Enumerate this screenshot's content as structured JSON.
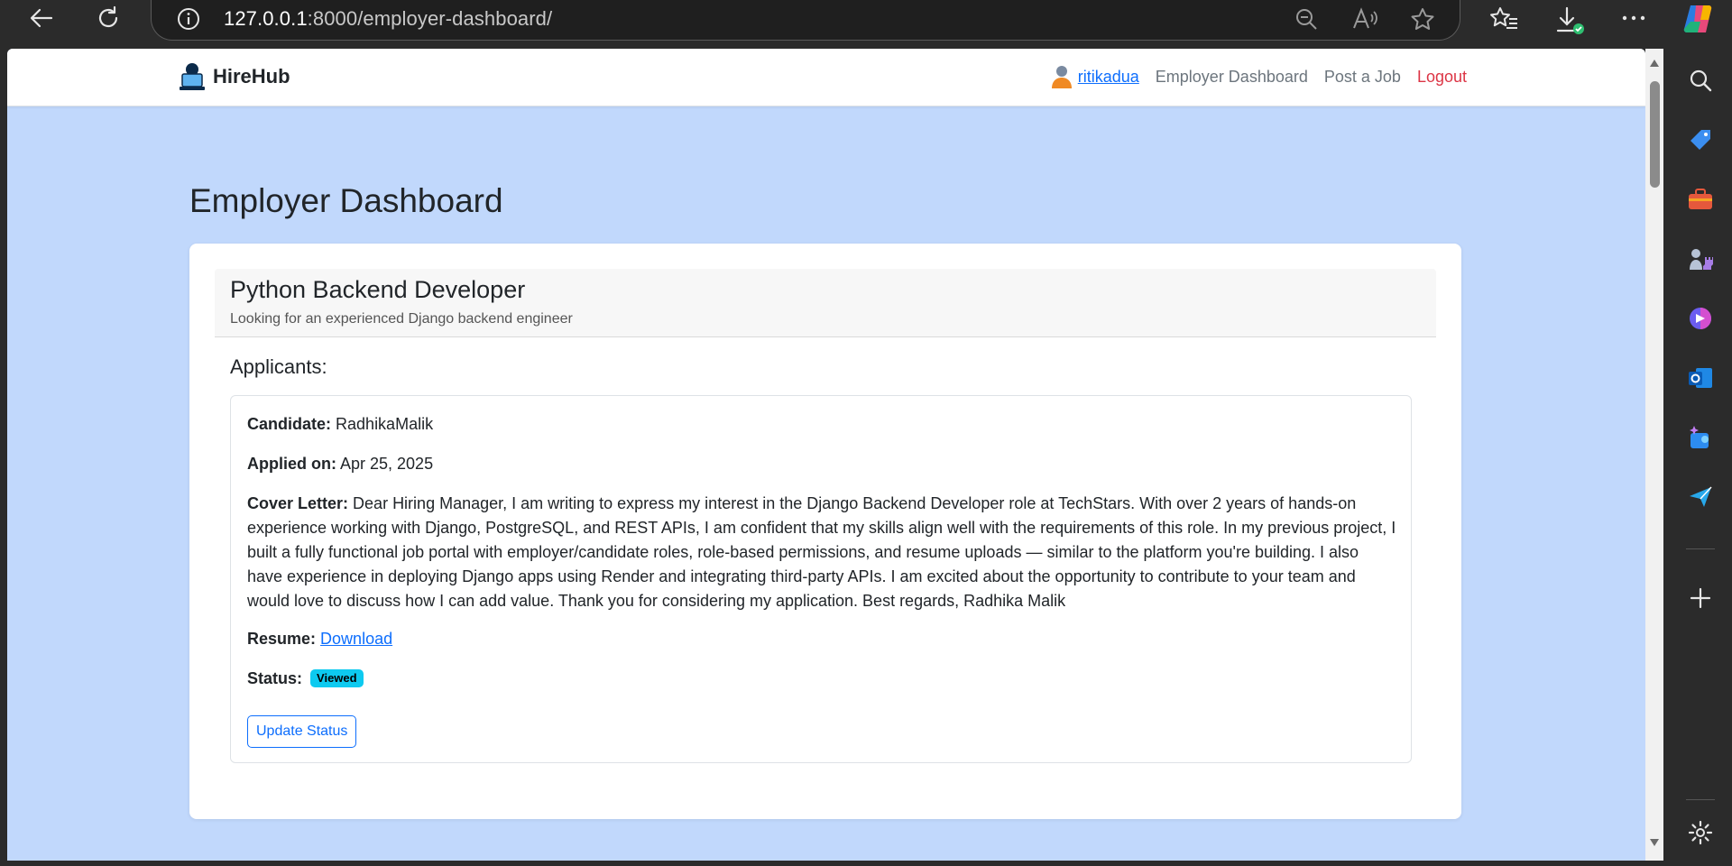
{
  "browser": {
    "url_host": "127.0.0.1",
    "url_rest": ":8000/employer-dashboard/"
  },
  "navbar": {
    "brand": "HireHub",
    "username": "ritikadua",
    "links": [
      "Employer Dashboard",
      "Post a Job",
      "Logout"
    ]
  },
  "page": {
    "title": "Employer Dashboard"
  },
  "job": {
    "title": "Python Backend Developer",
    "description": "Looking for an experienced Django backend engineer",
    "applicants_heading": "Applicants:"
  },
  "applicant": {
    "candidate_label": "Candidate:",
    "candidate": "RadhikaMalik",
    "applied_label": "Applied on:",
    "applied_on": "Apr 25, 2025",
    "cover_label": "Cover Letter:",
    "cover_letter": "Dear Hiring Manager, I am writing to express my interest in the Django Backend Developer role at TechStars. With over 2 years of hands-on experience working with Django, PostgreSQL, and REST APIs, I am confident that my skills align well with the requirements of this role. In my previous project, I built a fully functional job portal with employer/candidate roles, role-based permissions, and resume uploads — similar to the platform you're building. I also have experience in deploying Django apps using Render and integrating third-party APIs. I am excited about the opportunity to contribute to your team and would love to discuss how I can add value. Thank you for considering my application. Best regards, Radhika Malik",
    "resume_label": "Resume:",
    "resume_link": "Download",
    "status_label": "Status:",
    "status": "Viewed",
    "update_button": "Update Status"
  },
  "colors": {
    "page_bg": "#c1d8fc",
    "primary": "#0d6efd",
    "danger": "#dc3545",
    "badge_info": "#0dcaf0"
  }
}
